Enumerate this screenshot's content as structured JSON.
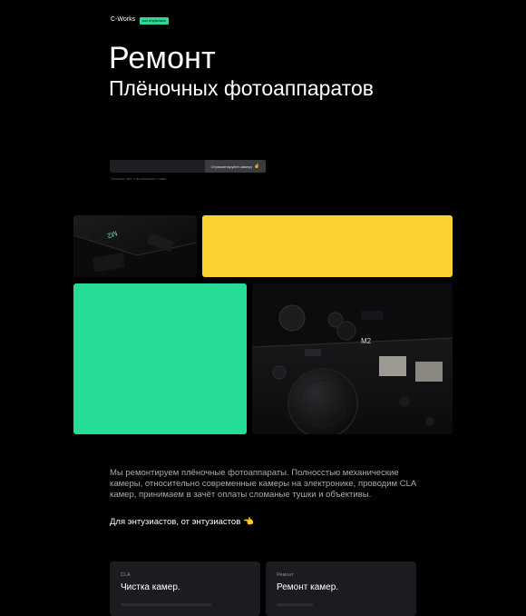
{
  "header": {
    "logo": "C-Works",
    "badge": "мы открылись"
  },
  "hero": {
    "title": "Ремонт",
    "subtitle": "Плёночных фотоаппаратов"
  },
  "form": {
    "input_placeholder": "",
    "submit_label": "Отремонтируйте камеру",
    "submit_icon": "☝",
    "note": "Напишите мне и мы свяжемся с вами"
  },
  "gallery": {
    "photo1_engraving": "M2",
    "photo2_engraving": "M2",
    "colors": {
      "yellow": "#fdd12f",
      "green": "#24dc94"
    }
  },
  "intro": {
    "text": "Мы ремонтируем плёночные фотоаппараты. Полносстью механические камеры, относительно современные камеры на электронике, проводим CLA камер, принимаем в зачёт оплаты сломаные тушки и объективы.",
    "tagline": "Для энтузиастов, от энтузиастов",
    "tagline_icon": "👈"
  },
  "services": [
    {
      "category": "CLA",
      "title": "Чистка камер."
    },
    {
      "category": "Ремонт",
      "title": "Ремонт камер."
    }
  ]
}
